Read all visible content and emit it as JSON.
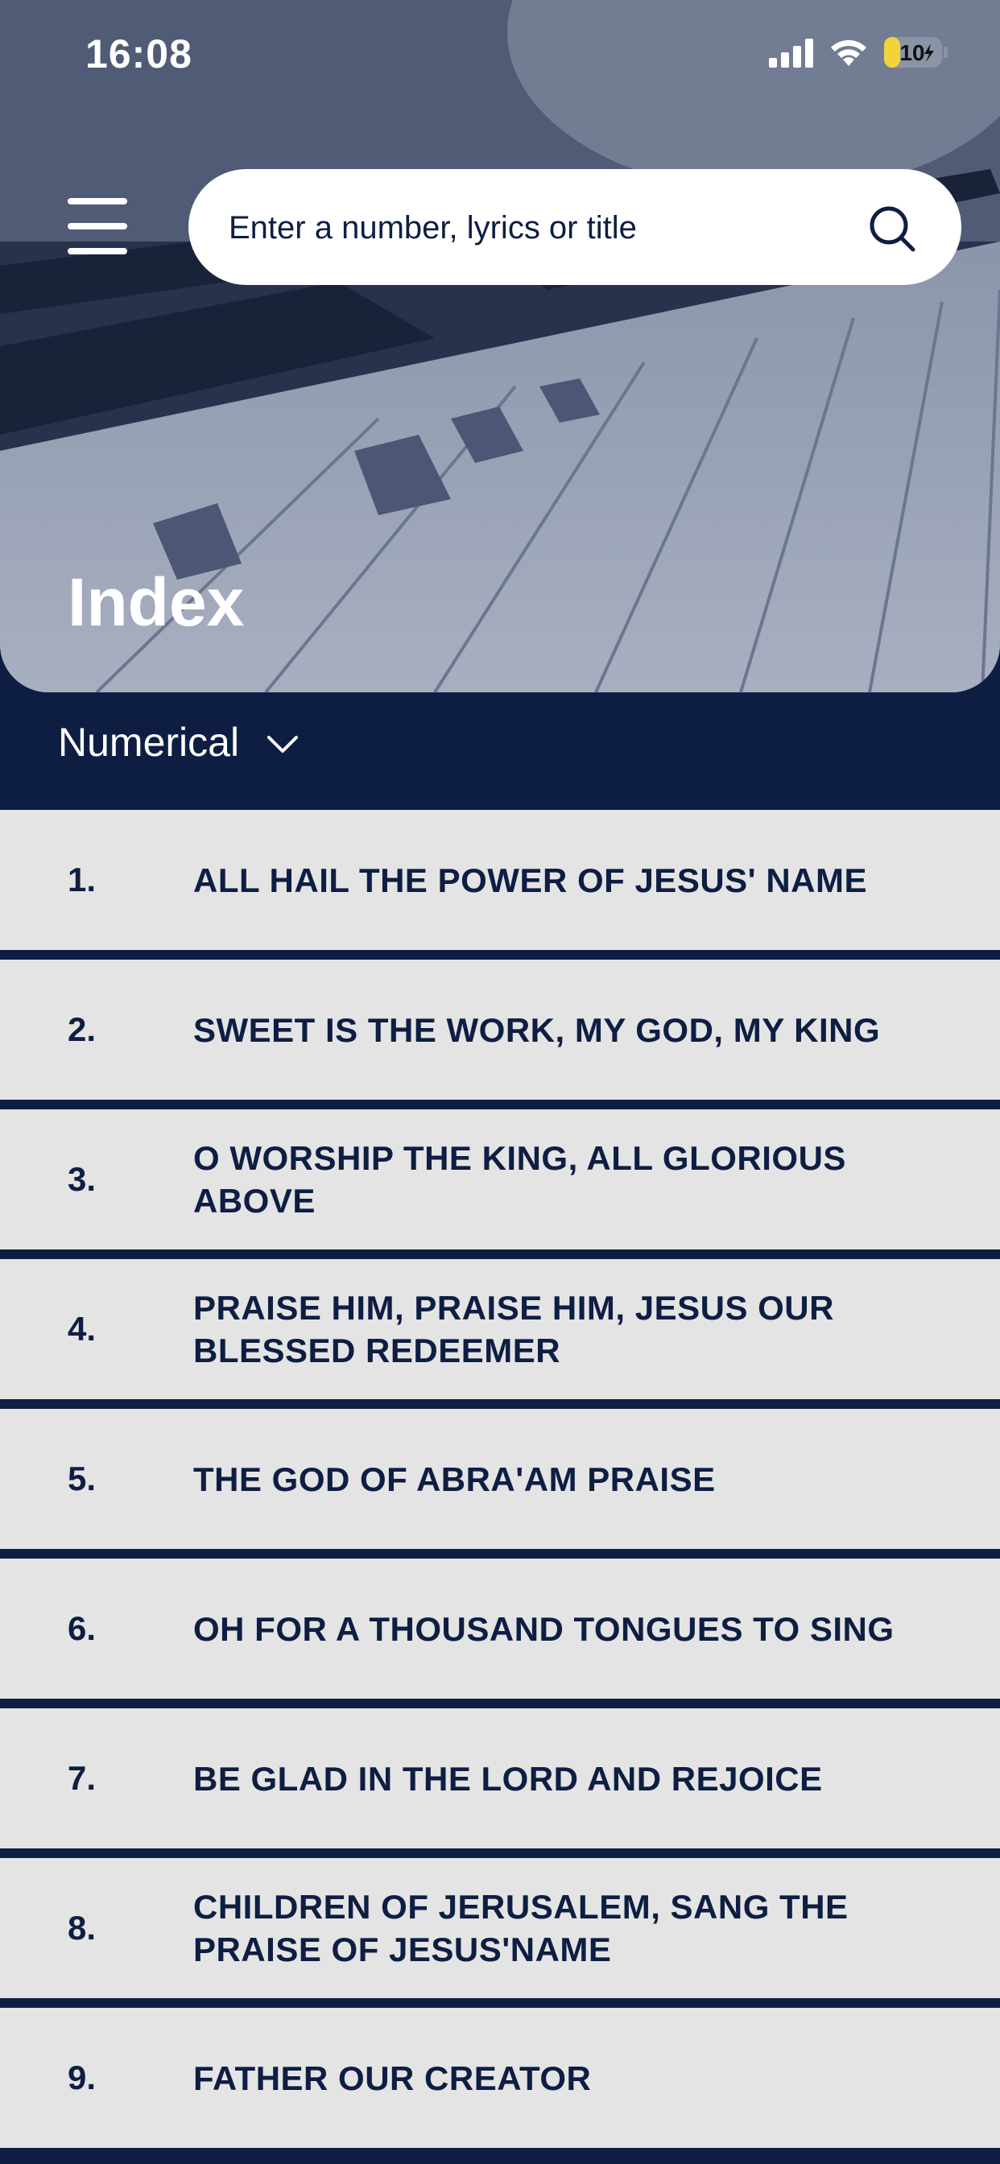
{
  "status_bar": {
    "time": "16:08",
    "battery_level": "10"
  },
  "header": {
    "search_placeholder": "Enter a number, lyrics or title",
    "title": "Index"
  },
  "sort": {
    "selected": "Numerical"
  },
  "hymns": [
    {
      "number": "1.",
      "title": "ALL HAIL THE POWER OF JESUS' NAME"
    },
    {
      "number": "2.",
      "title": "SWEET IS THE WORK, MY GOD, MY KING"
    },
    {
      "number": "3.",
      "title": "O WORSHIP THE KING, ALL GLORIOUS ABOVE"
    },
    {
      "number": "4.",
      "title": "PRAISE HIM, PRAISE HIM, JESUS OUR BLESSED REDEEMER"
    },
    {
      "number": "5.",
      "title": "THE GOD OF ABRA'AM PRAISE"
    },
    {
      "number": "6.",
      "title": "OH FOR A THOUSAND TONGUES TO SING"
    },
    {
      "number": "7.",
      "title": "BE GLAD IN THE LORD AND REJOICE"
    },
    {
      "number": "8.",
      "title": "CHILDREN OF JERUSALEM, SANG THE PRAISE OF JESUS'NAME"
    },
    {
      "number": "9.",
      "title": "FATHER OUR CREATOR"
    }
  ],
  "colors": {
    "navy": "#0e1e43",
    "row_background": "#e4e4e4",
    "battery_fill": "#f4d33a"
  },
  "icons": {
    "menu": "hamburger-menu-icon",
    "search": "search-icon",
    "sort_toggle": "chevron-down-icon"
  }
}
